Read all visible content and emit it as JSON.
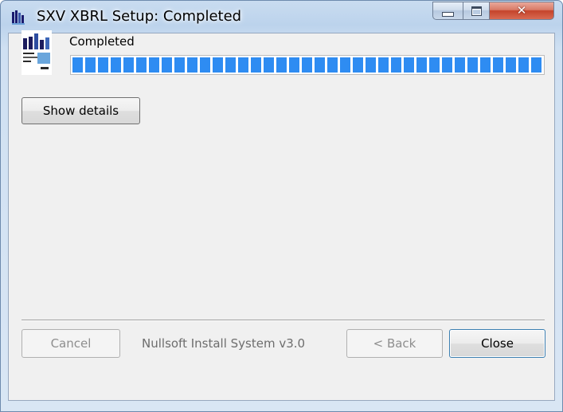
{
  "window": {
    "title": "SXV XBRL Setup: Completed",
    "icon": "installer-app-icon",
    "controls": {
      "minimize": "minimize-icon",
      "maximize": "maximize-icon",
      "close": "close-icon"
    }
  },
  "status": {
    "text": "Completed",
    "progress_fraction": 1.0
  },
  "buttons": {
    "show_details": "Show details",
    "cancel": "Cancel",
    "back": "< Back",
    "close": "Close"
  },
  "branding": "Nullsoft Install System v3.0",
  "colors": {
    "progress": "#2e8cf2",
    "close_button_red": "#c4432a",
    "title_bar": "#bcd3ec"
  }
}
